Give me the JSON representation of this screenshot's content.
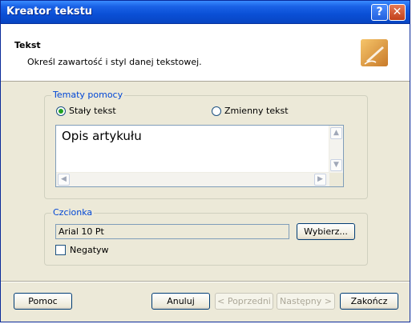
{
  "window": {
    "title": "Kreator tekstu",
    "help_symbol": "?",
    "close_symbol": "✕"
  },
  "header": {
    "title": "Tekst",
    "subtitle": "Określ zawartość i styl danej tekstowej.",
    "icon": "pen-and-paper-icon"
  },
  "topics_group": {
    "label": "Tematy pomocy",
    "radio_static": {
      "label": "Stały tekst",
      "checked": true
    },
    "radio_variable": {
      "label": "Zmienny tekst",
      "checked": false
    },
    "text_value": "Opis artykułu"
  },
  "font_group": {
    "label": "Czcionka",
    "font_value": "Arial 10 Pt",
    "choose_button": "Wybierz...",
    "negative_checkbox": {
      "label": "Negatyw",
      "checked": false
    }
  },
  "footer": {
    "help_button": "Pomoc",
    "cancel_button": "Anuluj",
    "back_button": "< Poprzedni",
    "next_button": "Następny >",
    "finish_button": "Zakończ"
  }
}
